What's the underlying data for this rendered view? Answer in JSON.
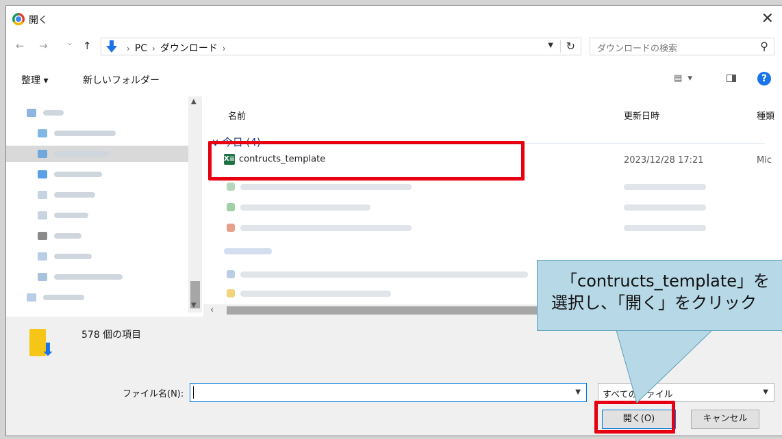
{
  "window": {
    "title": "開く",
    "close_glyph": "✕"
  },
  "nav": {
    "back_glyph": "←",
    "forward_glyph": "→",
    "recent_glyph": "⌄",
    "up_glyph": "↑",
    "crumbs": [
      "PC",
      "ダウンロード"
    ],
    "crumb_separator": "›",
    "refresh_glyph": "↻",
    "search_placeholder": "ダウンロードの検索"
  },
  "toolbar": {
    "organize_label": "整理 ▾",
    "new_folder_label": "新しいフォルダー",
    "view_glyph": "▤ ▾",
    "help_glyph": "?"
  },
  "columns": {
    "name": "名前",
    "date": "更新日時",
    "type": "種類"
  },
  "group": {
    "label": "∨ 今日 (4)"
  },
  "file": {
    "icon_glyph": "X≡",
    "name": "contructs_template",
    "date": "2023/12/28 17:21",
    "type": "Mic"
  },
  "details": {
    "count_label": "578 個の項目"
  },
  "bottom": {
    "filename_label": "ファイル名(N):",
    "filename_value": "",
    "type_value": "すべてのファイル",
    "open_label": "開く(O)",
    "cancel_label": "キャンセル"
  },
  "annotation": {
    "line1": "「contructs_template」を",
    "line2": "選択し、「開く」をクリック",
    "highlight_color": "#e60012",
    "callout_color": "#b7d8e6"
  }
}
